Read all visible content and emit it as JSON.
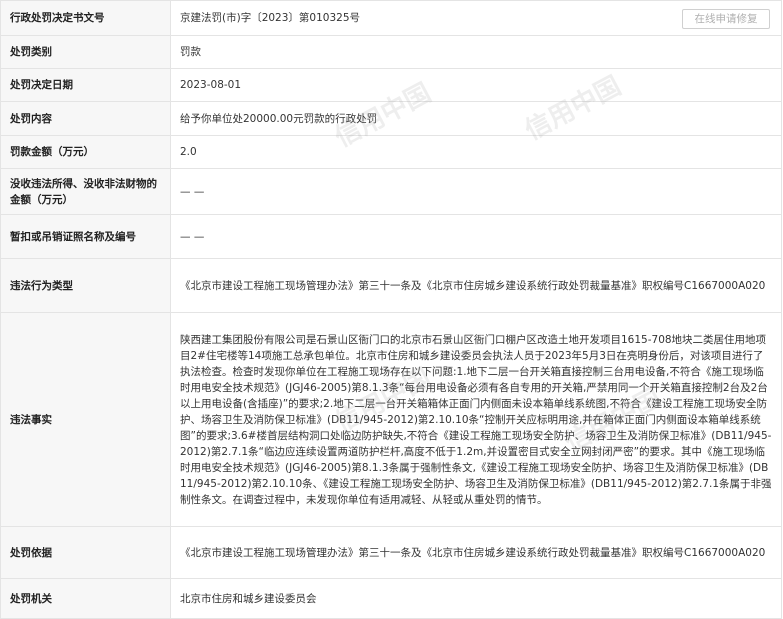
{
  "record": {
    "repair_button": "在线申请修复",
    "rows": [
      {
        "label": "行政处罚决定书文号",
        "value": "京建法罚(市)字〔2023〕第010325号"
      },
      {
        "label": "处罚类别",
        "value": "罚款"
      },
      {
        "label": "处罚决定日期",
        "value": "2023-08-01"
      },
      {
        "label": "处罚内容",
        "value": "给予你单位处20000.00元罚款的行政处罚"
      },
      {
        "label": "罚款金额（万元）",
        "value": "2.0"
      },
      {
        "label": "没收违法所得、没收非法财物的金额（万元）",
        "value": "— —"
      },
      {
        "label": "暂扣或吊销证照名称及编号",
        "value": "— —"
      },
      {
        "label": "违法行为类型",
        "value": "《北京市建设工程施工现场管理办法》第三十一条及《北京市住房城乡建设系统行政处罚裁量基准》职权编号C1667000A020"
      },
      {
        "label": "违法事实",
        "value": "陕西建工集团股份有限公司是石景山区衙门口的北京市石景山区衙门口棚户区改造土地开发项目1615-708地块二类居住用地项目2#住宅楼等14项施工总承包单位。北京市住房和城乡建设委员会执法人员于2023年5月3日在亮明身份后，对该项目进行了执法检查。检查时发现你单位在工程施工现场存在以下问题:1.地下二层一台开关箱直接控制三台用电设备,不符合《施工现场临时用电安全技术规范》(JGJ46-2005)第8.1.3条“每台用电设备必须有各自专用的开关箱,严禁用同一个开关箱直接控制2台及2台以上用电设备(含插座)”的要求;2.地下二层一台开关箱箱体正面门内侧面未设本箱单线系统图,不符合《建设工程施工现场安全防护、场容卫生及消防保卫标准》(DB11/945-2012)第2.10.10条“控制开关应标明用途,并在箱体正面门内侧面设本箱单线系统图”的要求;3.6#楼首层结构洞口处临边防护缺失,不符合《建设工程施工现场安全防护、场容卫生及消防保卫标准》(DB11/945-2012)第2.7.1条“临边应连续设置两道防护栏杆,高度不低于1.2m,并设置密目式安全立网封闭严密”的要求。其中《施工现场临时用电安全技术规范》(JGJ46-2005)第8.1.3条属于强制性条文,《建设工程施工现场安全防护、场容卫生及消防保卫标准》(DB11/945-2012)第2.10.10条、《建设工程施工现场安全防护、场容卫生及消防保卫标准》(DB11/945-2012)第2.7.1条属于非强制性条文。在调查过程中，未发现你单位有适用减轻、从轻或从重处罚的情节。"
      },
      {
        "label": "处罚依据",
        "value": "《北京市建设工程施工现场管理办法》第三十一条及《北京市住房城乡建设系统行政处罚裁量基准》职权编号C1667000A020"
      },
      {
        "label": "处罚机关",
        "value": "北京市住房和城乡建设委员会"
      }
    ]
  },
  "watermark": "信用中国"
}
